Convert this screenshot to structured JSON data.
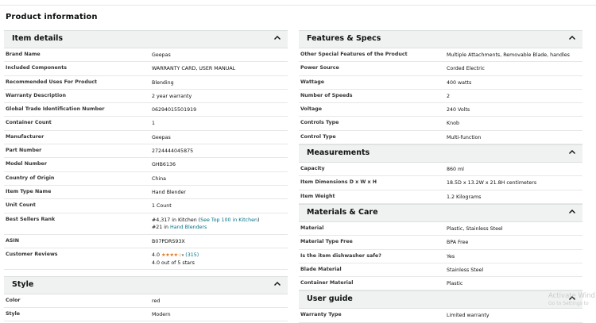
{
  "page_title": "Product information",
  "item_details": {
    "title": "Item details",
    "rows": [
      {
        "label": "Brand Name",
        "value": "Geepas"
      },
      {
        "label": "Included Components",
        "value": "WARRANTY CARD, USER MANUAL"
      },
      {
        "label": "Recommended Uses For Product",
        "value": "Blending"
      },
      {
        "label": "Warranty Description",
        "value": "2 year warranty"
      },
      {
        "label": "Global Trade Identification Number",
        "value": "06294015501919"
      },
      {
        "label": "Container Count",
        "value": "1"
      },
      {
        "label": "Manufacturer",
        "value": "Geepas"
      },
      {
        "label": "Part Number",
        "value": "2724444045875"
      },
      {
        "label": "Model Number",
        "value": "GHB6136"
      },
      {
        "label": "Country of Origin",
        "value": "China"
      },
      {
        "label": "Item Type Name",
        "value": "Hand Blender"
      },
      {
        "label": "Unit Count",
        "value": "1 Count"
      }
    ],
    "best_sellers": {
      "label": "Best Sellers Rank",
      "line1_rank": "#4,317 in Kitchen (",
      "line1_link": "See Top 100 in Kitchen",
      "line1_end": ")",
      "line2_rank": "#21 in ",
      "line2_link": "Hand Blenders"
    },
    "asin": {
      "label": "ASIN",
      "value": "B07PDRS93X"
    },
    "reviews": {
      "label": "Customer Reviews",
      "rating": "4.0",
      "stars": "★★★★☆",
      "caret": "▾",
      "count_link": "(315)",
      "summary": "4.0 out of 5 stars"
    }
  },
  "style": {
    "title": "Style",
    "rows": [
      {
        "label": "Color",
        "value": "red"
      },
      {
        "label": "Style",
        "value": "Modern"
      }
    ]
  },
  "features": {
    "title": "Features & Specs",
    "rows": [
      {
        "label": "Other Special Features of the Product",
        "value": "Multiple Attachments, Removable Blade, handles"
      },
      {
        "label": "Power Source",
        "value": "Corded Electric"
      },
      {
        "label": "Wattage",
        "value": "400 watts"
      },
      {
        "label": "Number of Speeds",
        "value": "2"
      },
      {
        "label": "Voltage",
        "value": "240 Volts"
      },
      {
        "label": "Controls Type",
        "value": "Knob"
      },
      {
        "label": "Control Type",
        "value": "Multi-function"
      }
    ]
  },
  "measurements": {
    "title": "Measurements",
    "rows": [
      {
        "label": "Capacity",
        "value": "860 ml"
      },
      {
        "label": "Item Dimensions D x W x H",
        "value": "18.5D x 13.2W x 21.8H centimeters"
      },
      {
        "label": "Item Weight",
        "value": "1.2 Kilograms"
      }
    ]
  },
  "materials": {
    "title": "Materials & Care",
    "rows": [
      {
        "label": "Material",
        "value": "Plastic, Stainless Steel"
      },
      {
        "label": "Material Type Free",
        "value": "BPA Free"
      },
      {
        "label": "Is the item dishwasher safe?",
        "value": "Yes"
      },
      {
        "label": "Blade Material",
        "value": "Stainless Steel"
      },
      {
        "label": "Container Material",
        "value": "Plastic"
      }
    ]
  },
  "user_guide": {
    "title": "User guide",
    "rows": [
      {
        "label": "Warranty Type",
        "value": "Limited warranty"
      }
    ]
  },
  "watermark": {
    "line1": "Activate Wind",
    "line2": "Go to Settings to"
  },
  "colors": {
    "link": "#007185",
    "star": "#de7921",
    "section_header_bg": "#f0f2f2"
  },
  "icons": {
    "collapse": "chevron-up-icon"
  }
}
